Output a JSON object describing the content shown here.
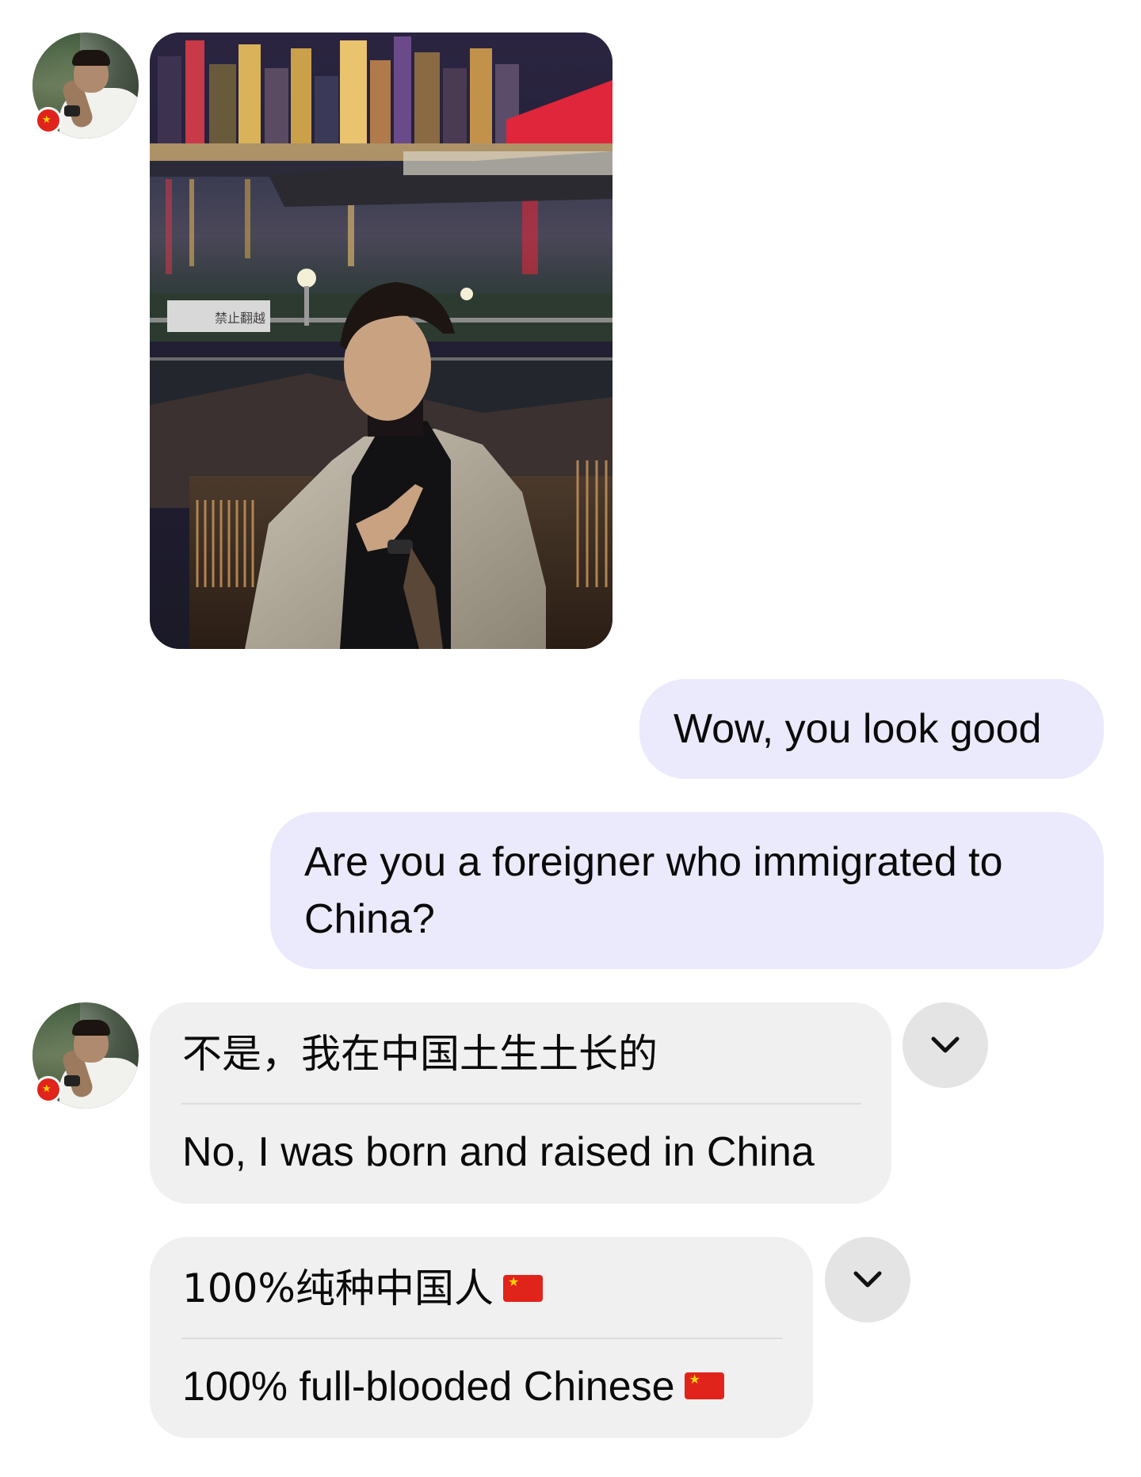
{
  "colors": {
    "outgoing_bubble": "#ebe9fc",
    "incoming_bubble": "#f0f0f0",
    "chevron_button": "#e4e4e4",
    "flag_red": "#e0241b",
    "flag_star": "#ffd400"
  },
  "photo": {
    "sign_text": "禁止翻越"
  },
  "messages": [
    {
      "direction": "incoming",
      "type": "image",
      "sender_avatar": "avatar-with-china-flag-badge"
    },
    {
      "direction": "outgoing",
      "type": "text",
      "text": "Wow, you look good"
    },
    {
      "direction": "outgoing",
      "type": "text",
      "line1": "Are you a foreigner who immigrated to",
      "line2": "China?"
    },
    {
      "direction": "incoming",
      "type": "translated_text",
      "original": "不是，我在中国土生土长的",
      "translation": "No, I was born and raised in China",
      "action_icon": "chevron-down-icon"
    },
    {
      "direction": "incoming",
      "type": "translated_text",
      "original": "100%纯种中国人",
      "original_emoji": "flag-china-icon",
      "translation": "100% full-blooded Chinese",
      "translation_emoji": "flag-china-icon",
      "action_icon": "chevron-down-icon"
    }
  ]
}
